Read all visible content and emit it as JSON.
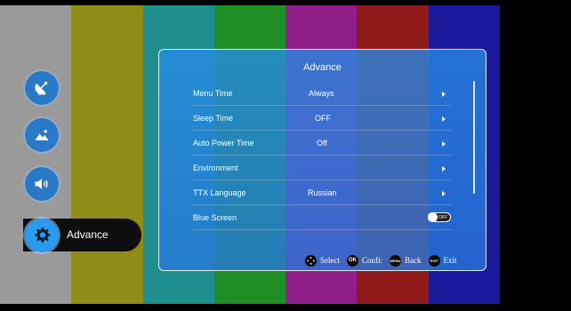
{
  "colors": {
    "bars": [
      "#9a9a9a",
      "#8f8c17",
      "#1f8e8e",
      "#1e8e25",
      "#8f1e8b",
      "#8e1a1a",
      "#1b1a9c",
      "#000000"
    ],
    "panel_accent": "#2a8ae6"
  },
  "nav": {
    "items": [
      {
        "icon": "satellite-dish-icon"
      },
      {
        "icon": "picture-icon"
      },
      {
        "icon": "speaker-icon"
      },
      {
        "icon": "gear-icon",
        "label": "Advance",
        "active": true
      }
    ]
  },
  "panel": {
    "title": "Advance",
    "rows": [
      {
        "label": "Menu Time",
        "value": "Always",
        "arrow": true
      },
      {
        "label": "Sleep Time",
        "value": "OFF",
        "arrow": true
      },
      {
        "label": "Auto Power Time",
        "value": "Off",
        "arrow": true
      },
      {
        "label": "Environment",
        "value": "",
        "arrow": true
      },
      {
        "label": "TTX Language",
        "value": "Russian",
        "arrow": true
      },
      {
        "label": "Blue Screen",
        "toggle_text": "OFF",
        "toggle": true
      }
    ]
  },
  "footer": {
    "hints": [
      {
        "icon": "dpad-icon",
        "button_text": "",
        "label": "Select"
      },
      {
        "icon": "ok-button-icon",
        "button_text": "OK",
        "label": "Confi:"
      },
      {
        "icon": "menu-button-icon",
        "button_text": "MENU",
        "label": "Back"
      },
      {
        "icon": "exit-button-icon",
        "button_text": "EXIT",
        "label": "Exit"
      }
    ]
  }
}
